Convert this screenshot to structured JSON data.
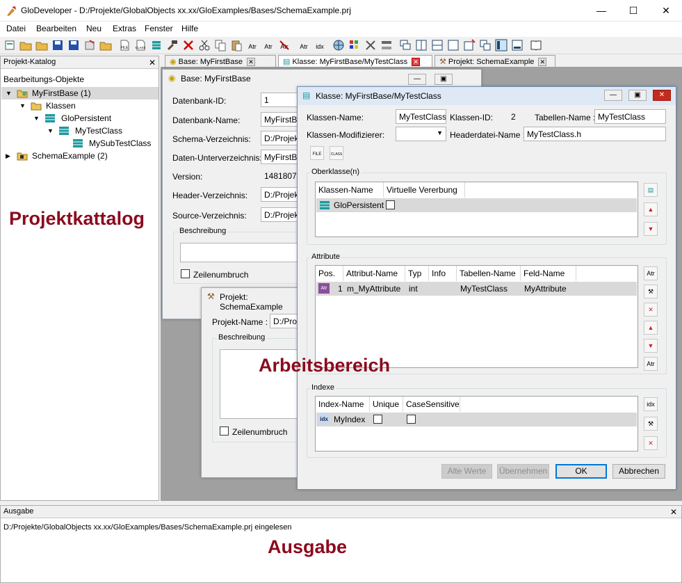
{
  "app": {
    "title": "GloDeveloper - D:/Projekte/GlobalObjects xx.xx/GloExamples/Bases/SchemaExample.prj",
    "minimize": "—",
    "maximize": "☐",
    "close": "✕"
  },
  "menu": [
    "Datei",
    "Bearbeiten",
    "Neu",
    "Extras",
    "Fenster",
    "Hilfe"
  ],
  "catalog": {
    "header": "Projekt-Katalog",
    "close": "✕",
    "column": "Bearbeitungs-Objekte",
    "items": [
      "MyFirstBase (1)",
      "Klassen",
      "GloPersistent",
      "MyTestClass",
      "MySubTestClass",
      "SchemaExample (2)"
    ],
    "overlay": "Projektkattalog"
  },
  "tabs": [
    "Base: MyFirstBase",
    "Klasse: MyFirstBase/MyTestClass",
    "Projekt: SchemaExample"
  ],
  "base": {
    "title": "Base: MyFirstBase",
    "labels": [
      "Datenbank-ID:",
      "Datenbank-Name:",
      "Schema-Verzeichnis:",
      "Daten-Unterverzeichnis:",
      "Version:",
      "Header-Verzeichnis:",
      "Source-Verzeichnis:"
    ],
    "values": [
      "1",
      "MyFirstBase",
      "D:/Projekte",
      "MyFirstBase",
      "148180717",
      "D:/Projekte",
      "D:/Projekte"
    ],
    "desc": "Beschreibung",
    "wrap": "Zeilenumbruch"
  },
  "project": {
    "title": "Projekt: SchemaExample",
    "name_label": "Projekt-Name :",
    "name_value": "D:/Projekte",
    "desc": "Beschreibung",
    "wrap": "Zeilenumbruch"
  },
  "klass": {
    "title": "Klasse: MyFirstBase/MyTestClass",
    "name_label": "Klassen-Name:",
    "name_value": "MyTestClass",
    "id_label": "Klassen-ID:",
    "id_value": "2",
    "table_label": "Tabellen-Name :",
    "table_value": "MyTestClass",
    "mod_label": "Klassen-Modifizierer:",
    "mod_value": "",
    "header_label": "Headerdatei-Name :",
    "header_value": "MyTestClass.h",
    "file_btn": "FILE",
    "class_btn": "CLASS",
    "super": {
      "title": "Oberklasse(n)",
      "cols": [
        "Klassen-Name",
        "Virtuelle Vererbung"
      ],
      "row": "GloPersistent"
    },
    "attr": {
      "title": "Attribute",
      "cols": [
        "Pos.",
        "Attribut-Name",
        "Typ",
        "Info",
        "Tabellen-Name",
        "Feld-Name"
      ],
      "row": [
        "1",
        "m_MyAttribute",
        "int",
        "",
        "MyTestClass",
        "MyAttribute"
      ],
      "icon": "Atr"
    },
    "index": {
      "title": "Indexe",
      "cols": [
        "Index-Name",
        "Unique",
        "CaseSensitive"
      ],
      "row": "MyIndex",
      "icon": "idx"
    },
    "buttons": [
      "Alte Werte",
      "Übernehmen",
      "OK",
      "Abbrechen"
    ]
  },
  "overlay_work": "Arbeitsbereich",
  "output": {
    "header": "Ausgabe",
    "close": "✕",
    "line": "D:/Projekte/GlobalObjects xx.xx/GloExamples/Bases/SchemaExample.prj eingelesen",
    "overlay": "Ausgabe"
  },
  "colors": {
    "overlay": "#8b0a1e",
    "selection": "#d9d9d9",
    "workspace": "#a0a0a0"
  }
}
